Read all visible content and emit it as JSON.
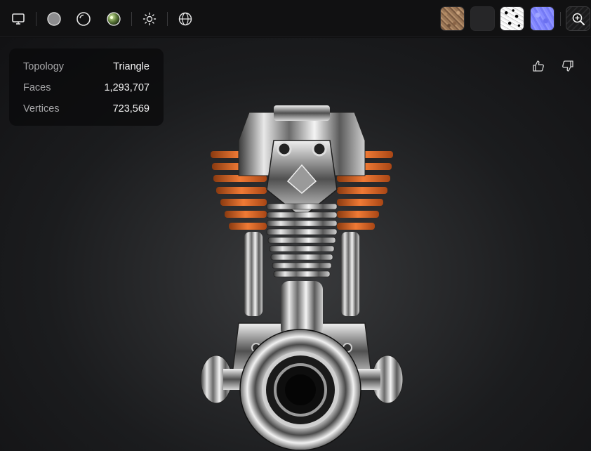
{
  "toolbar": {
    "buttons": [
      {
        "name": "monitor-icon"
      },
      {
        "name": "solid-shading-icon"
      },
      {
        "name": "wireframe-shading-icon"
      },
      {
        "name": "material-shading-icon"
      },
      {
        "name": "lighting-icon"
      },
      {
        "name": "environment-globe-icon"
      }
    ],
    "texture_maps": [
      {
        "name": "base-color-map"
      },
      {
        "name": "roughness-map"
      },
      {
        "name": "metallic-map"
      },
      {
        "name": "normal-map"
      }
    ],
    "zoom": {
      "name": "zoom-in-icon"
    }
  },
  "stats": {
    "topology_label": "Topology",
    "topology_value": "Triangle",
    "faces_label": "Faces",
    "faces_value": "1,293,707",
    "vertices_label": "Vertices",
    "vertices_value": "723,569"
  },
  "feedback": {
    "like": "thumbs-up-icon",
    "dislike": "thumbs-down-icon"
  },
  "colors": {
    "accent_orange": "#e06a2a",
    "chrome": "#c8c8c8",
    "background": "#0f0f10"
  }
}
